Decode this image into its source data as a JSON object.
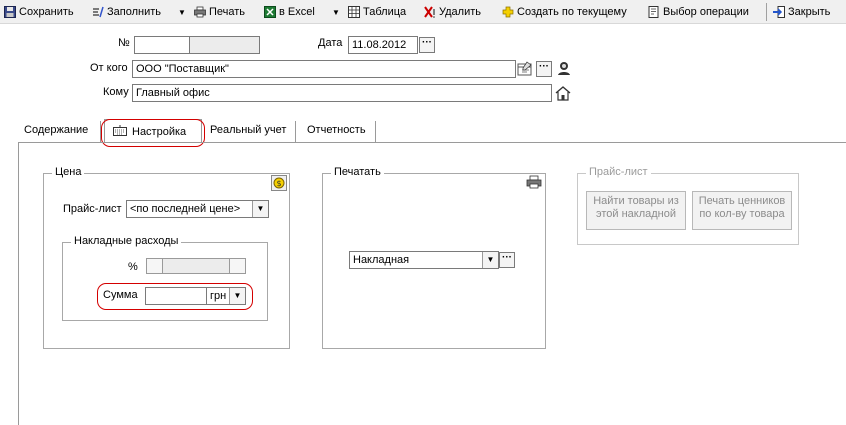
{
  "toolbar": {
    "save": "Сохранить",
    "fill": "Заполнить",
    "print": "Печать",
    "excel": "в Excel",
    "table": "Таблица",
    "delete": "Удалить",
    "create_by_current": "Создать по текущему",
    "choose_operation": "Выбор операции",
    "close": "Закрыть"
  },
  "header": {
    "number_label": "№",
    "number_value": "",
    "date_label": "Дата",
    "date_value": "11.08.2012",
    "from_label": "От кого",
    "from_value": "ООО \"Поставщик\"",
    "to_label": "Кому",
    "to_value": "Главный офис"
  },
  "tabs": [
    "Содержание",
    "Настройка",
    "Реальный учет",
    "Отчетность"
  ],
  "active_tab": "Настройка",
  "price_group": {
    "title": "Цена",
    "pricelist_label": "Прайс-лист",
    "pricelist_value": "<по последней цене>",
    "overhead_title": "Накладные расходы",
    "percent_label": "%",
    "sum_label": "Сумма",
    "sum_value": "",
    "currency": "грн"
  },
  "print_group": {
    "title": "Печатать",
    "form_value": "Накладная"
  },
  "pricelist_group": {
    "title": "Прайс-лист",
    "find_goods_button": "Найти товары из этой накладной",
    "print_tags_button": "Печать ценников по кол-ву товара"
  },
  "colors": {
    "highlight": "#d40000",
    "toolbar_bg": "#f0f0f0"
  }
}
